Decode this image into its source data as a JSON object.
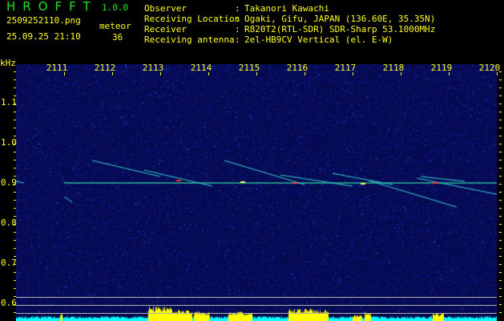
{
  "app": {
    "title": "HROFFT",
    "version": "1.0.0"
  },
  "file": {
    "name": "2509252110.png",
    "datetime": "25.09.25 21:10"
  },
  "meteor": {
    "label": "meteor",
    "count": "36"
  },
  "info": [
    {
      "label": "Observer",
      "value": "Takanori Kawachi"
    },
    {
      "label": "Receiving Location",
      "value": "Ogaki, Gifu, JAPAN (136.60E, 35.35N)"
    },
    {
      "label": "Receiver",
      "value": "R820T2(RTL-SDR) SDR-Sharp 53.1000MHz"
    },
    {
      "label": "Receiving antenna",
      "value": "2el-HB9CV Vertical (el. E-W)"
    }
  ],
  "axis": {
    "freq_unit": "kHz",
    "time_labels": [
      "2111",
      "2112",
      "2113",
      "2114",
      "2115",
      "2116",
      "2117",
      "2118",
      "2119",
      "2120"
    ],
    "freq_labels": [
      "1.1",
      "1.0",
      "0.9",
      "0.8",
      "0.7",
      "0.6"
    ]
  },
  "colors": {
    "text": "#ffff20",
    "title": "#20e020",
    "noise": "#0a1490",
    "histogram": "#00ffff",
    "histogram_peak": "#ffff00"
  }
}
